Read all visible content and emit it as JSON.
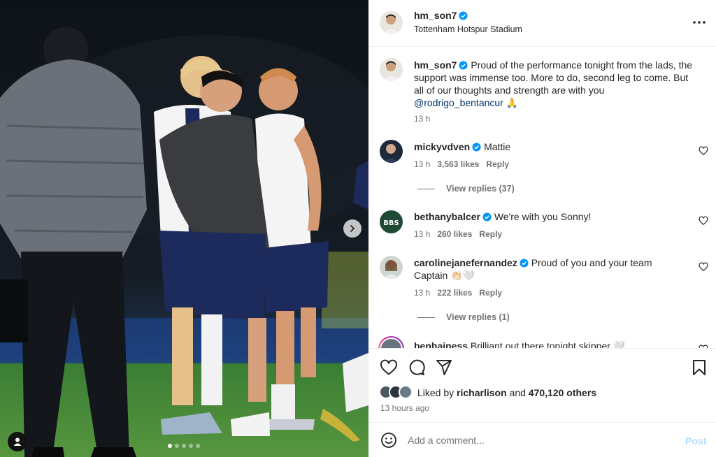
{
  "post": {
    "username": "hm_son7",
    "location": "Tottenham Hotspur Stadium",
    "caption_text": "Proud of the performance tonight from the lads, the support was immense too. More to do, second leg to come. But all of our thoughts and strength are with you",
    "caption_mention": "@rodrigo_bentancur",
    "caption_emoji": "🙏",
    "caption_time": "13 h",
    "carousel_dots": 5,
    "active_dot": 0
  },
  "comments": [
    {
      "username": "mickyvdven",
      "text": "Mattie",
      "time": "13 h",
      "likes": "3,563 likes",
      "reply": "Reply",
      "view_replies": "View replies (37)"
    },
    {
      "username": "bethanybalcer",
      "text": "We're with you Sonny!",
      "time": "13 h",
      "likes": "260 likes",
      "reply": "Reply"
    },
    {
      "username": "carolinejanefernandez",
      "text": "Proud of you and your team Captain 👏🏻🤍",
      "time": "13 h",
      "likes": "222 likes",
      "reply": "Reply",
      "view_replies": "View replies (1)"
    },
    {
      "username": "benhainess",
      "text": "Brilliant out there tonight skipper 🤍"
    }
  ],
  "footer": {
    "liked_by_prefix": "Liked by",
    "liked_by_user": "richarlison",
    "liked_by_and": "and",
    "liked_by_others": "470,120 others",
    "time_ago": "13 hours ago",
    "comment_placeholder": "Add a comment...",
    "post_label": "Post"
  },
  "colors": {
    "verified": "#0095f6",
    "link": "#00376b",
    "post_disabled": "#b2dffc",
    "muted": "#737373"
  },
  "icons": [
    "more-icon",
    "heart-icon",
    "comment-icon",
    "share-icon",
    "bookmark-icon",
    "emoji-icon",
    "chevron-right-icon",
    "user-tag-icon",
    "verified-badge-icon"
  ]
}
